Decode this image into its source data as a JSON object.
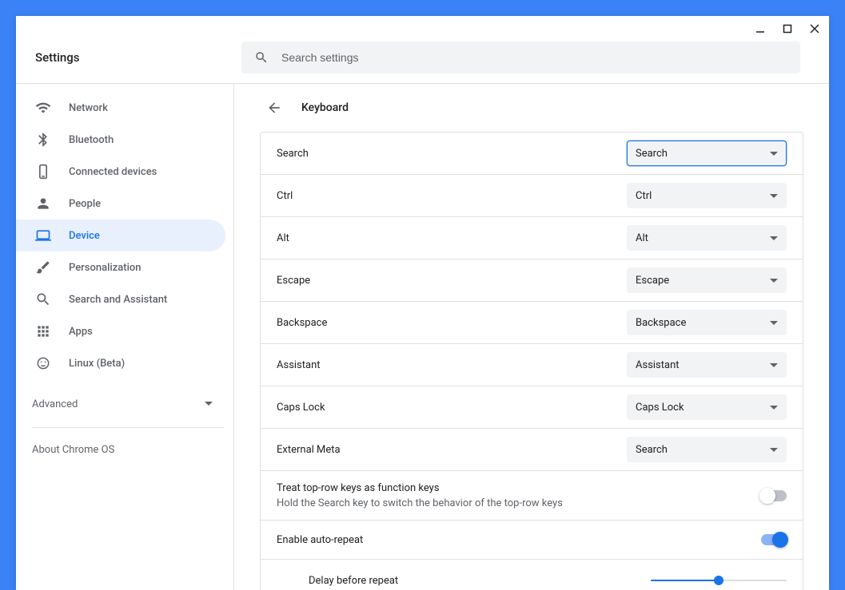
{
  "header": {
    "title": "Settings",
    "search_placeholder": "Search settings"
  },
  "sidebar": {
    "items": [
      {
        "label": "Network"
      },
      {
        "label": "Bluetooth"
      },
      {
        "label": "Connected devices"
      },
      {
        "label": "People"
      },
      {
        "label": "Device"
      },
      {
        "label": "Personalization"
      },
      {
        "label": "Search and Assistant"
      },
      {
        "label": "Apps"
      },
      {
        "label": "Linux (Beta)"
      }
    ],
    "advanced": "Advanced",
    "about": "About Chrome OS"
  },
  "page": {
    "title": "Keyboard",
    "rows": [
      {
        "label": "Search",
        "value": "Search"
      },
      {
        "label": "Ctrl",
        "value": "Ctrl"
      },
      {
        "label": "Alt",
        "value": "Alt"
      },
      {
        "label": "Escape",
        "value": "Escape"
      },
      {
        "label": "Backspace",
        "value": "Backspace"
      },
      {
        "label": "Assistant",
        "value": "Assistant"
      },
      {
        "label": "Caps Lock",
        "value": "Caps Lock"
      },
      {
        "label": "External Meta",
        "value": "Search"
      }
    ],
    "function_keys": {
      "title": "Treat top-row keys as function keys",
      "subtitle": "Hold the Search key to switch the behavior of the top-row keys",
      "enabled": false
    },
    "auto_repeat": {
      "title": "Enable auto-repeat",
      "enabled": true
    },
    "delay": {
      "label": "Delay before repeat",
      "percent": 50
    }
  }
}
